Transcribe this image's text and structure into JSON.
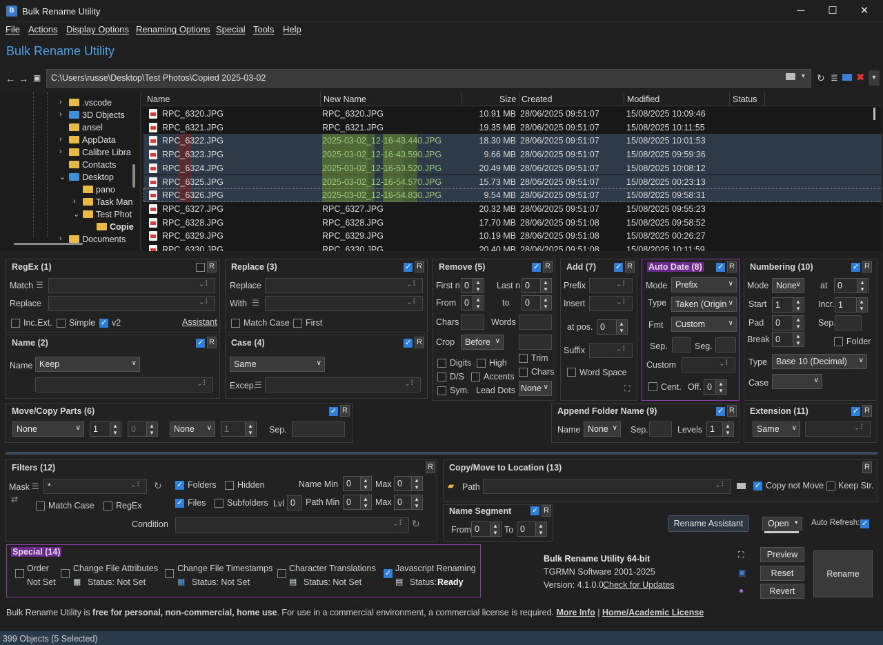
{
  "window": {
    "title": "Bulk Rename Utility",
    "min": "─",
    "max": "☐",
    "close": "✕"
  },
  "menu": [
    "File",
    "Actions",
    "Display Options",
    "Renaming Options",
    "Special",
    "Tools",
    "Help"
  ],
  "header": {
    "title": "Bulk Rename Utility"
  },
  "path": {
    "value": "C:\\Users\\russe\\Desktop\\Test Photos\\Copied 2025-03-02"
  },
  "tree": [
    {
      "label": ".vscode",
      "depth": 1,
      "expandable": true
    },
    {
      "label": "3D Objects",
      "depth": 1,
      "expandable": true,
      "color": "blue"
    },
    {
      "label": "ansel",
      "depth": 1,
      "expandable": false
    },
    {
      "label": "AppData",
      "depth": 1,
      "expandable": true
    },
    {
      "label": "Calibre Libra",
      "depth": 1,
      "expandable": true
    },
    {
      "label": "Contacts",
      "depth": 1,
      "expandable": false
    },
    {
      "label": "Desktop",
      "depth": 1,
      "expandable": true,
      "expanded": true,
      "color": "blue"
    },
    {
      "label": "pano",
      "depth": 2,
      "expandable": false
    },
    {
      "label": "Task Man",
      "depth": 2,
      "expandable": true
    },
    {
      "label": "Test Phot",
      "depth": 2,
      "expandable": true,
      "expanded": true
    },
    {
      "label": "Copie",
      "depth": 3,
      "expandable": false,
      "bold": true
    },
    {
      "label": "Documents",
      "depth": 1,
      "expandable": true
    }
  ],
  "grid": {
    "columns": [
      "Name",
      "New Name",
      "Size",
      "Created",
      "Modified",
      "Status"
    ],
    "rows": [
      {
        "name": "RPC_6320.JPG",
        "new": "RPC_6320.JPG",
        "size": "10.91 MB",
        "created": "28/06/2025 09:51:07",
        "modified": "15/08/2025 10:09:46",
        "sel": false
      },
      {
        "name": "RPC_6321.JPG",
        "new": "RPC_6321.JPG",
        "size": "19.35 MB",
        "created": "28/06/2025 09:51:07",
        "modified": "15/08/2025 10:11:55",
        "sel": false
      },
      {
        "name": "RPC_6322.JPG",
        "new": "2025-03-02_12-16-43.440.JPG",
        "size": "18.30 MB",
        "created": "28/06/2025 09:51:07",
        "modified": "15/08/2025 10:01:53",
        "sel": true
      },
      {
        "name": "RPC_6323.JPG",
        "new": "2025-03-02_12-16-43.590.JPG",
        "size": "9.66 MB",
        "created": "28/06/2025 09:51:07",
        "modified": "15/08/2025 09:59:36",
        "sel": true
      },
      {
        "name": "RPC_6324.JPG",
        "new": "2025-03-02_12-16-53.520.JPG",
        "size": "20.49 MB",
        "created": "28/06/2025 09:51:07",
        "modified": "15/08/2025 10:08:12",
        "sel": true
      },
      {
        "name": "RPC_6325.JPG",
        "new": "2025-03-02_12-16-54.570.JPG",
        "size": "15.73 MB",
        "created": "28/06/2025 09:51:07",
        "modified": "15/08/2025 00:23:13",
        "sel": true
      },
      {
        "name": "RPC_6326.JPG",
        "new": "2025-03-02_12-16-54.830.JPG",
        "size": "9.54 MB",
        "created": "28/06/2025 09:51:07",
        "modified": "15/08/2025 09:58:31",
        "sel": true,
        "focus": true
      },
      {
        "name": "RPC_6327.JPG",
        "new": "RPC_6327.JPG",
        "size": "20.32 MB",
        "created": "28/06/2025 09:51:07",
        "modified": "15/08/2025 09:55:23",
        "sel": false
      },
      {
        "name": "RPC_6328.JPG",
        "new": "RPC_6328.JPG",
        "size": "17.70 MB",
        "created": "28/06/2025 09:51:08",
        "modified": "15/08/2025 09:58:52",
        "sel": false
      },
      {
        "name": "RPC_6329.JPG",
        "new": "RPC_6329.JPG",
        "size": "10.19 MB",
        "created": "28/06/2025 09:51:08",
        "modified": "15/08/2025 00:26:27",
        "sel": false
      },
      {
        "name": "RPC_6330.JPG",
        "new": "RPC_6330.JPG",
        "size": "20.40 MB",
        "created": "28/06/2025 09:51:08",
        "modified": "15/08/2025 10:11:59",
        "sel": false
      }
    ]
  },
  "regex": {
    "title": "RegEx (1)",
    "match": "Match",
    "replace": "Replace",
    "incext": "Inc.Ext.",
    "simple": "Simple",
    "v2": "v2",
    "assistant": "Assistant"
  },
  "replace": {
    "title": "Replace (3)",
    "replace": "Replace",
    "with": "With",
    "matchcase": "Match Case",
    "first": "First"
  },
  "remove": {
    "title": "Remove (5)",
    "firstn": "First n",
    "lastn": "Last n",
    "from": "From",
    "to": "to",
    "chars": "Chars",
    "words": "Words",
    "crop": "Crop",
    "crop_val": "Before",
    "digits": "Digits",
    "high": "High",
    "trim": "Trim",
    "ds": "D/S",
    "accents": "Accents",
    "chars2": "Chars",
    "sym": "Sym.",
    "leaddots": "Lead Dots",
    "ld_val": "None",
    "v0": "0"
  },
  "add": {
    "title": "Add (7)",
    "prefix": "Prefix",
    "insert": "Insert",
    "atpos": "at pos.",
    "suffix": "Suffix",
    "wordspace": "Word Space",
    "v0": "0"
  },
  "autodate": {
    "title": "Auto Date (8)",
    "mode": "Mode",
    "mode_val": "Prefix",
    "type": "Type",
    "type_val": "Taken (Origin",
    "fmt": "Fmt",
    "fmt_val": "Custom",
    "sep": "Sep.",
    "seg": "Seg.",
    "custom": "Custom",
    "cent": "Cent.",
    "off": "Off.",
    "off_val": "0"
  },
  "numbering": {
    "title": "Numbering (10)",
    "mode": "Mode",
    "mode_val": "None",
    "at": "at",
    "at_val": "0",
    "start": "Start",
    "start_val": "1",
    "incr": "Incr.",
    "incr_val": "1",
    "pad": "Pad",
    "pad_val": "0",
    "sep": "Sep.",
    "break": "Break",
    "break_val": "0",
    "folder": "Folder",
    "type": "Type",
    "type_val": "Base 10 (Decimal)",
    "case": "Case"
  },
  "name": {
    "title": "Name (2)",
    "name": "Name",
    "name_val": "Keep"
  },
  "case": {
    "title": "Case (4)",
    "case_val": "Same",
    "excep": "Excep."
  },
  "movecopy": {
    "title": "Move/Copy Parts (6)",
    "v1": "None",
    "n1": "1",
    "n2": "0",
    "v2": "None",
    "n3": "1",
    "sep": "Sep."
  },
  "appendfolder": {
    "title": "Append Folder Name (9)",
    "name": "Name",
    "name_val": "None",
    "sep": "Sep.",
    "levels": "Levels",
    "levels_val": "1"
  },
  "extension": {
    "title": "Extension (11)",
    "val": "Same"
  },
  "filters": {
    "title": "Filters (12)",
    "mask": "Mask",
    "mask_val": "*",
    "folders": "Folders",
    "hidden": "Hidden",
    "files": "Files",
    "subfolders": "Subfolders",
    "lvl": "Lvl",
    "lvl_val": "0",
    "namemin": "Name Min",
    "pathmin": "Path Min",
    "max": "Max",
    "v0": "0",
    "matchcase": "Match Case",
    "regex": "RegEx",
    "condition": "Condition"
  },
  "copymove": {
    "title": "Copy/Move to Location (13)",
    "path": "Path",
    "copynotmove": "Copy not Move",
    "keepstr": "Keep Str."
  },
  "namesegment": {
    "title": "Name Segment",
    "from": "From",
    "from_val": "0",
    "to": "To",
    "to_val": "0"
  },
  "actions": {
    "assistant": "Rename Assistant",
    "open": "Open",
    "autorefresh": "Auto Refresh:"
  },
  "special": {
    "title": "Special (14)",
    "order": "Order",
    "order_status": "Not Set",
    "attrs": "Change File Attributes",
    "attrs_status": "Status:  Not Set",
    "timestamps": "Change File Timestamps",
    "ts_status": "Status:  Not Set",
    "chartrans": "Character Translations",
    "ct_status": "Status:  Not Set",
    "js": "Javascript Renaming",
    "js_status_label": "Status:",
    "js_status": "Ready"
  },
  "about": {
    "name": "Bulk Rename Utility 64-bit",
    "company": "TGRMN Software 2001-2025",
    "version": "Version: 4.1.0.0",
    "updates": "Check for Updates"
  },
  "buttons": {
    "preview": "Preview",
    "reset": "Reset",
    "revert": "Revert",
    "rename": "Rename",
    "r": "R"
  },
  "info": {
    "p1": "Bulk Rename Utility is ",
    "p2": "free for personal, non-commercial, home use",
    "p3": ". For use in a commercial environment, a commercial license is required. ",
    "more": "More Info",
    "bar": "|",
    "home": "Home/Academic License"
  },
  "status": {
    "text": "399 Objects (5 Selected)"
  }
}
